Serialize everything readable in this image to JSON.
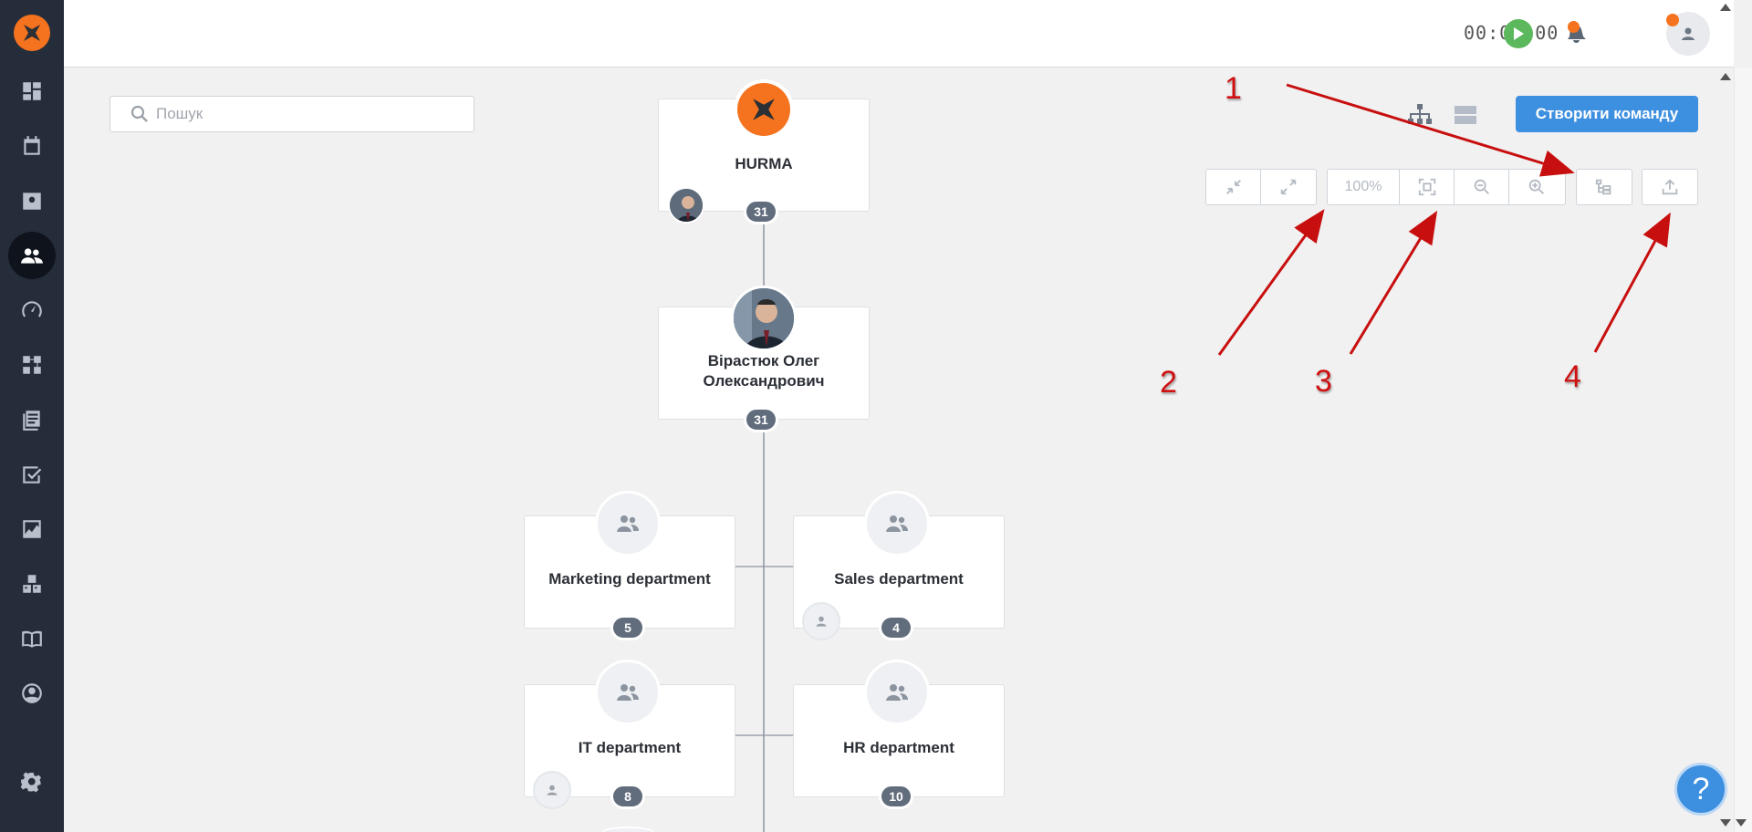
{
  "app": {
    "brand_color": "#f5731e",
    "sidebar_color": "#252d3a",
    "accent_color": "#3d8fe0"
  },
  "sidebar": {
    "items": [
      {
        "name": "dashboard-icon",
        "active": false
      },
      {
        "name": "calendar-icon",
        "active": false
      },
      {
        "name": "profile-card-icon",
        "active": false
      },
      {
        "name": "team-icon",
        "active": true
      },
      {
        "name": "speedometer-icon",
        "active": false
      },
      {
        "name": "workflow-icon",
        "active": false
      },
      {
        "name": "documents-icon",
        "active": false
      },
      {
        "name": "checklist-icon",
        "active": false
      },
      {
        "name": "analytics-icon",
        "active": false
      },
      {
        "name": "boxes-icon",
        "active": false
      },
      {
        "name": "book-icon",
        "active": false
      },
      {
        "name": "user-circle-icon",
        "active": false
      },
      {
        "name": "gear-icon",
        "active": false
      }
    ]
  },
  "topbar": {
    "timer": "00:00:00"
  },
  "search": {
    "placeholder": "Пошук"
  },
  "toolbar": {
    "create_team_label": "Створити команду",
    "zoom_level": "100%"
  },
  "annotations": {
    "n1": "1",
    "n2": "2",
    "n3": "3",
    "n4": "4"
  },
  "org": {
    "root": {
      "title": "HURMA",
      "count": "31"
    },
    "head": {
      "name_line1": "Вірастюк Олег",
      "name_line2": "Олександрович",
      "count": "31"
    },
    "departments": [
      {
        "title": "Marketing department",
        "count": "5"
      },
      {
        "title": "Sales department",
        "count": "4"
      },
      {
        "title": "IT department",
        "count": "8"
      },
      {
        "title": "HR department",
        "count": "10"
      }
    ]
  },
  "help": {
    "label": "?"
  }
}
